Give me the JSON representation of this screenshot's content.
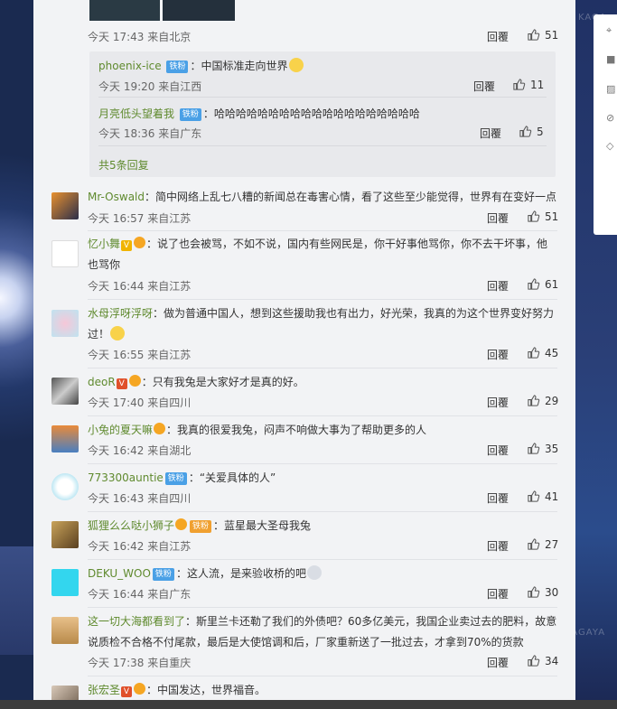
{
  "watermarks": [
    "KAGA",
    "KAGAYA"
  ],
  "top_comment": {
    "time": "今天 17:43 来自北京",
    "reply": "回覆",
    "likes": "51",
    "subreplies": [
      {
        "name": "phoenix-ice",
        "badge": "铁粉",
        "text": "中国标准走向世界",
        "time": "今天 19:20 来自江西",
        "reply": "回覆",
        "likes": "11"
      },
      {
        "name": "月亮低头望着我",
        "badge": "铁粉",
        "text": "哈哈哈哈哈哈哈哈哈哈哈哈哈哈哈哈哈哈哈",
        "time": "今天 18:36 来自广东",
        "reply": "回覆",
        "likes": "5"
      }
    ],
    "more": "共5条回复"
  },
  "comments": [
    {
      "name": "Mr-Oswald",
      "text": "：简中网络上乱七八糟的新闻总在毒害心情，看了这些至少能觉得，世界有在变好一点",
      "time": "今天 16:57 来自江苏",
      "reply": "回覆",
      "likes": "51"
    },
    {
      "name": "忆小舞",
      "text": "：说了也会被骂，不如不说，国内有些网民是，你干好事他骂你，你不去干坏事，他",
      "text2": "也骂你",
      "time": "今天 16:44 来自江苏",
      "reply": "回覆",
      "likes": "61"
    },
    {
      "name": "水母浮呀浮呀",
      "text": "：做为普通中国人，想到这些援助我也有出力，好光荣，我真的为这个世界变好努力",
      "text2": "过！",
      "time": "今天 16:55 来自江苏",
      "reply": "回覆",
      "likes": "45"
    },
    {
      "name": "deoR",
      "text": "：只有我兔是大家好才是真的好。",
      "time": "今天 17:40 来自四川",
      "reply": "回覆",
      "likes": "29"
    },
    {
      "name": "小兔的夏天嘛",
      "text": "：我真的很爱我兔，闷声不响做大事为了帮助更多的人",
      "time": "今天 16:42 来自湖北",
      "reply": "回覆",
      "likes": "35"
    },
    {
      "name": "773300auntie",
      "badge": "铁粉",
      "text": "：“关爱具体的人”",
      "time": "今天 16:43 来自四川",
      "reply": "回覆",
      "likes": "41"
    },
    {
      "name": "狐狸么么哒小狮子",
      "badge": "铁粉",
      "text": "：蓝星最大圣母我兔",
      "time": "今天 16:42 来自江苏",
      "reply": "回覆",
      "likes": "27"
    },
    {
      "name": "DEKU_WOO",
      "badge": "铁粉",
      "text": "：这人流，是来验收桥的吧",
      "time": "今天 16:44 来自广东",
      "reply": "回覆",
      "likes": "30"
    },
    {
      "name": "这一切大海都看到了",
      "text": "：斯里兰卡还勒了我们的外债吧？60多亿美元，我国企业卖过去的肥料，故意",
      "text2": "说质检不合格不付尾款，最后是大使馆调和后，厂家重新送了一批过去，才拿到70%的货款",
      "time": "今天 17:38 来自重庆",
      "reply": "回覆",
      "likes": "34"
    },
    {
      "name": "张宏圣",
      "text": "：中国发达，世界福音。",
      "time": "",
      "reply": "",
      "likes": ""
    }
  ],
  "colors": {
    "panel_bg": "#f2f3f5",
    "name_green": "#5f8a2e",
    "badge_blue": "#4aa0e6"
  }
}
